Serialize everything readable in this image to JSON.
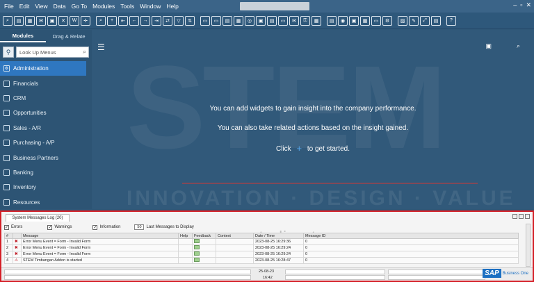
{
  "menu": [
    "File",
    "Edit",
    "View",
    "Data",
    "Go To",
    "Modules",
    "Tools",
    "Window",
    "Help"
  ],
  "left_panel": {
    "tabs": [
      "Modules",
      "Drag & Relate"
    ],
    "search_placeholder": "Look Up Menus",
    "modules": [
      {
        "label": "Administration",
        "icon": "gear-icon",
        "active": true
      },
      {
        "label": "Financials",
        "icon": "ledger-icon"
      },
      {
        "label": "CRM",
        "icon": "crm-icon"
      },
      {
        "label": "Opportunities",
        "icon": "opportunities-icon"
      },
      {
        "label": "Sales - A/R",
        "icon": "sales-icon"
      },
      {
        "label": "Purchasing - A/P",
        "icon": "purchasing-icon"
      },
      {
        "label": "Business Partners",
        "icon": "partners-icon"
      },
      {
        "label": "Banking",
        "icon": "bank-icon"
      },
      {
        "label": "Inventory",
        "icon": "inventory-icon"
      },
      {
        "label": "Resources",
        "icon": "resources-icon"
      }
    ]
  },
  "main": {
    "line1": "You can add widgets to gain insight into the company performance.",
    "line2": "You can also take related actions based on the insight gained.",
    "line3_pre": "Click",
    "line3_post": "to get started.",
    "watermark": "STEM",
    "tagline": "INNOVATION · DESIGN · VALUE"
  },
  "messages": {
    "tab_label": "System Messages Log (20)",
    "filters": {
      "errors": "Errors",
      "warnings": "Warnings",
      "information": "Information",
      "count": "50",
      "count_label": "Last Messages to Display"
    },
    "columns": [
      "#",
      "",
      "Message",
      "Help",
      "Feedback",
      "Context",
      "Date / Time",
      "Message ID"
    ],
    "rows": [
      {
        "n": "1",
        "type": "error",
        "message": "Error Menu Event = Form - Invalid Form",
        "datetime": "2023-08-25  16:29:36",
        "id": "0"
      },
      {
        "n": "2",
        "type": "error",
        "message": "Error Menu Event = Form - Invalid Form",
        "datetime": "2023-08-25  16:29:24",
        "id": "0"
      },
      {
        "n": "3",
        "type": "error",
        "message": "Error Menu Event = Form - Invalid Form",
        "datetime": "2023-08-25  16:29:24",
        "id": "0"
      },
      {
        "n": "4",
        "type": "info",
        "message": "STEM Timbangan Addon is started",
        "datetime": "2023-08-25  16:28:47",
        "id": "0"
      }
    ],
    "url_watermark": "www.sterling-team.com"
  },
  "status": {
    "date": "25-08-23",
    "time": "16:42",
    "logo": "SAP",
    "product": "Business One"
  }
}
